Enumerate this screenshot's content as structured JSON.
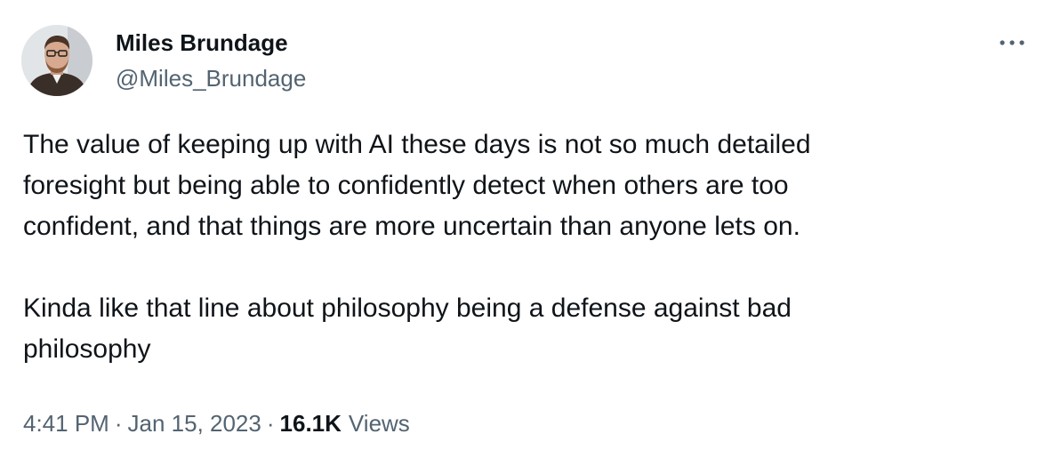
{
  "author": {
    "display_name": "Miles Brundage",
    "handle": "@Miles_Brundage",
    "avatar_icon": "profile-photo"
  },
  "more_icon": "ellipsis-icon",
  "tweet": {
    "paragraphs": [
      [
        "The value of keeping up with AI these days is not so much detailed",
        "foresight but being able to confidently detect when others are too",
        "confident, and that things are more uncertain than anyone lets on."
      ],
      [
        "Kinda like that line about philosophy being a defense against bad",
        "philosophy"
      ]
    ]
  },
  "meta": {
    "time": "4:41 PM",
    "separator": "·",
    "date": "Jan 15, 2023",
    "view_count": "16.1K",
    "views_label": "Views"
  },
  "colors": {
    "primary_text": "#0f1419",
    "secondary_text": "#536471",
    "background": "#ffffff"
  }
}
